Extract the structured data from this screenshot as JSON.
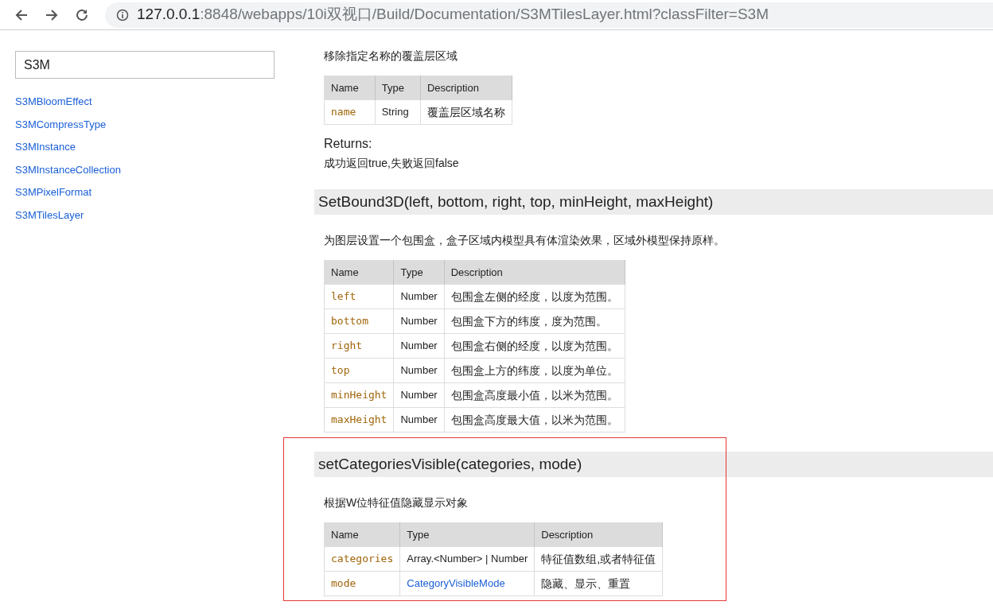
{
  "browser": {
    "url_host": "127.0.0.1",
    "url_rest": ":8848/webapps/10i双视口/Build/Documentation/S3MTilesLayer.html?classFilter=S3M"
  },
  "sidebar": {
    "search_value": "S3M",
    "items": [
      "S3MBloomEffect",
      "S3MCompressType",
      "S3MInstance",
      "S3MInstanceCollection",
      "S3MPixelFormat",
      "S3MTilesLayer"
    ]
  },
  "sections": [
    {
      "description": "移除指定名称的覆盖层区域",
      "columns": [
        "Name",
        "Type",
        "Description"
      ],
      "rows": [
        {
          "name": "name",
          "type": "String",
          "type_link": false,
          "description": "覆盖层区域名称"
        }
      ],
      "returns_label": "Returns:",
      "returns_text": "成功返回true,失败返回false",
      "highlighted": false
    },
    {
      "heading": "SetBound3D(left, bottom, right, top, minHeight, maxHeight)",
      "description": "为图层设置一个包围盒，盒子区域内模型具有体渲染效果，区域外模型保持原样。",
      "columns": [
        "Name",
        "Type",
        "Description"
      ],
      "rows": [
        {
          "name": "left",
          "type": "Number",
          "type_link": false,
          "description": "包围盒左侧的经度，以度为范围。"
        },
        {
          "name": "bottom",
          "type": "Number",
          "type_link": false,
          "description": "包围盒下方的纬度，度为范围。"
        },
        {
          "name": "right",
          "type": "Number",
          "type_link": false,
          "description": "包围盒右侧的经度，以度为范围。"
        },
        {
          "name": "top",
          "type": "Number",
          "type_link": false,
          "description": "包围盒上方的纬度，以度为单位。"
        },
        {
          "name": "minHeight",
          "type": "Number",
          "type_link": false,
          "description": "包围盒高度最小值，以米为范围。"
        },
        {
          "name": "maxHeight",
          "type": "Number",
          "type_link": false,
          "description": "包围盒高度最大值，以米为范围。"
        }
      ],
      "highlighted": false
    },
    {
      "heading": "setCategoriesVisible(categories, mode)",
      "description": "根据W位特征值隐藏显示对象",
      "columns": [
        "Name",
        "Type",
        "Description"
      ],
      "rows": [
        {
          "name": "categories",
          "type": "Array.<Number> | Number",
          "type_link": false,
          "description": "特征值数组,或者特征值"
        },
        {
          "name": "mode",
          "type": "CategoryVisibleMode",
          "type_link": true,
          "description": "隐藏、显示、重置"
        }
      ],
      "highlighted": true
    }
  ]
}
